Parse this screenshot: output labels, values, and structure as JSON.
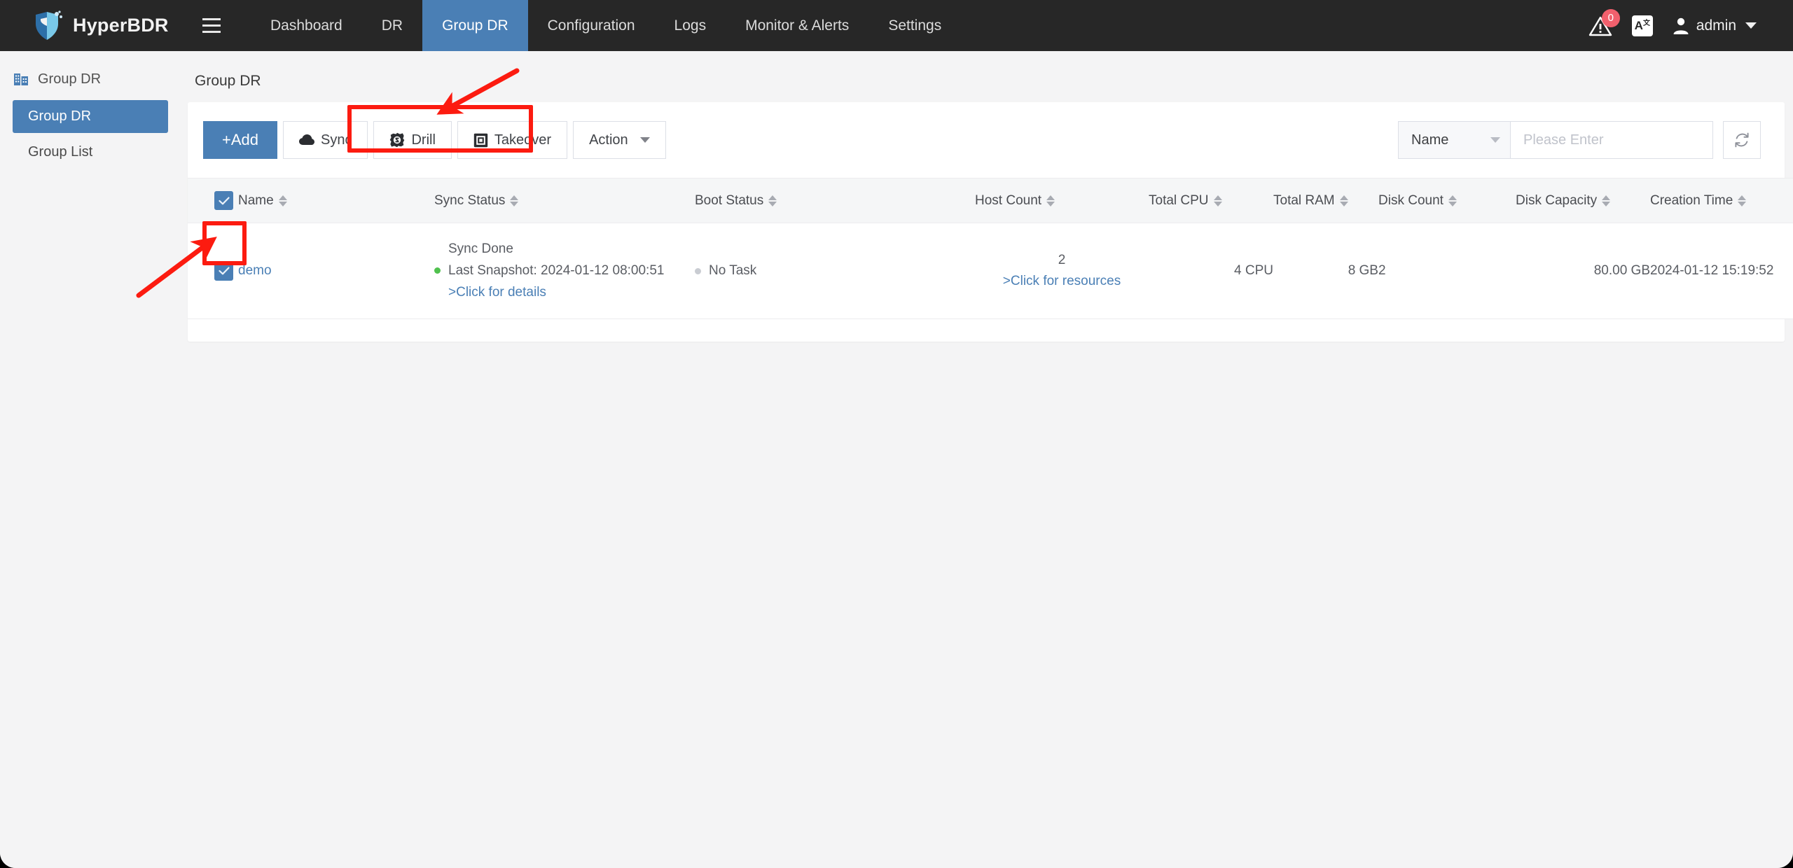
{
  "topnav": {
    "brand": "HyperBDR",
    "menu_icon": "hamburger-icon",
    "links": [
      {
        "label": "Dashboard",
        "active": false
      },
      {
        "label": "DR",
        "active": false
      },
      {
        "label": "Group DR",
        "active": true
      },
      {
        "label": "Configuration",
        "active": false
      },
      {
        "label": "Logs",
        "active": false
      },
      {
        "label": "Monitor & Alerts",
        "active": false
      },
      {
        "label": "Settings",
        "active": false
      }
    ],
    "alert_badge": "0",
    "alert_icon": "warning-bell-icon",
    "language_icon": "language-translate-icon",
    "user": "admin",
    "user_icon": "user-avatar-icon"
  },
  "sidebar": {
    "group_title": "Group DR",
    "group_icon": "building-icon",
    "items": [
      {
        "label": "Group DR",
        "active": true
      },
      {
        "label": "Group List",
        "active": false
      }
    ]
  },
  "main": {
    "page_title": "Group DR",
    "toolbar": {
      "add_label": "+Add",
      "sync_label": "Sync",
      "sync_icon": "cloud-icon",
      "drill_label": "Drill",
      "drill_icon": "drill-gear-icon",
      "takeover_label": "Takeover",
      "takeover_icon": "server-box-icon",
      "action_label": "Action",
      "action_icon": "chevron-down-icon"
    },
    "search": {
      "field_selected": "Name",
      "placeholder": "Please Enter",
      "search_icon": "search-icon",
      "refresh_icon": "refresh-icon"
    },
    "table": {
      "columns": [
        {
          "label": "Name",
          "sortable": true
        },
        {
          "label": "Sync Status",
          "sortable": true
        },
        {
          "label": "Boot Status",
          "sortable": true
        },
        {
          "label": "Host Count",
          "sortable": true
        },
        {
          "label": "Total CPU",
          "sortable": true
        },
        {
          "label": "Total RAM",
          "sortable": true
        },
        {
          "label": "Disk Count",
          "sortable": true
        },
        {
          "label": "Disk Capacity",
          "sortable": true
        },
        {
          "label": "Creation Time",
          "sortable": true
        }
      ],
      "rows": [
        {
          "selected": true,
          "name": "demo",
          "sync_status_title": "Sync Done",
          "sync_status_detail": "Last Snapshot: 2024-01-12 08:00:51",
          "sync_status_link": ">Click for details",
          "boot_status": "No Task",
          "host_count": "2",
          "host_count_link": ">Click for resources",
          "total_cpu": "4 CPU",
          "total_ram": "8 GB",
          "disk_count": "2",
          "disk_capacity": "80.00 GB",
          "creation_time": "2024-01-12 15:19:52"
        }
      ]
    }
  },
  "annotations": {
    "highlight_color": "#fc1b10",
    "shapes": [
      {
        "kind": "rect",
        "target": "drill-takeover-button-group"
      },
      {
        "kind": "rect",
        "target": "row-select-checkbox"
      },
      {
        "kind": "arrow",
        "target": "drill-takeover-button-group"
      },
      {
        "kind": "arrow",
        "target": "row-select-checkbox"
      }
    ]
  }
}
